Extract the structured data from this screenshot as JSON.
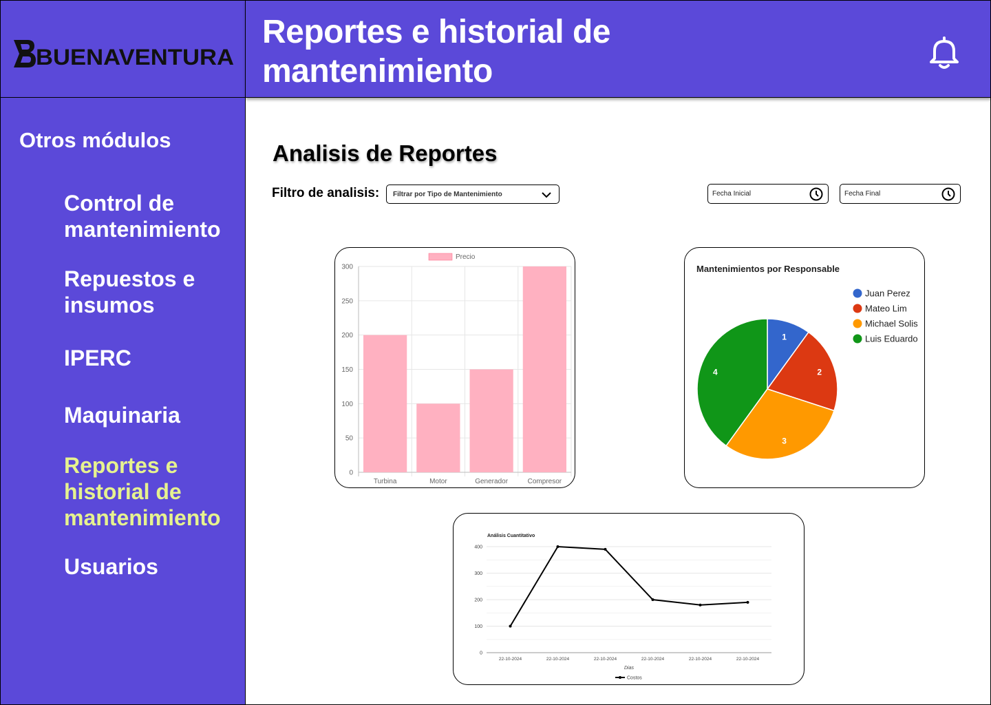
{
  "brand": {
    "logo_text": "BUENAVENTURA"
  },
  "header": {
    "title": "Reportes e historial de mantenimiento",
    "notification_icon": "bell-icon"
  },
  "sidebar": {
    "heading": "Otros módulos",
    "items": [
      {
        "label": "Control de mantenimiento",
        "active": false
      },
      {
        "label": "Repuestos e insumos",
        "active": false
      },
      {
        "label": "IPERC",
        "active": false
      },
      {
        "label": "Maquinaria",
        "active": false
      },
      {
        "label": "Reportes e historial de mantenimiento",
        "active": true
      },
      {
        "label": "Usuarios",
        "active": false
      }
    ]
  },
  "main": {
    "section_title": "Analisis de Reportes",
    "filter_label": "Filtro de analisis:",
    "filter_select": {
      "value": "Filtrar por Tipo de Mantenimiento",
      "icon": "chevron-down-icon"
    },
    "start_date": {
      "placeholder": "Fecha Inicial",
      "icon": "clock-icon"
    },
    "end_date": {
      "placeholder": "Fecha Final",
      "icon": "clock-icon"
    }
  },
  "colors": {
    "brand_purple": "#5b49d9",
    "active_nav": "#e6f28f",
    "bar_fill": "#ffb1c1",
    "pie": [
      "#3366cc",
      "#dc3912",
      "#ff9900",
      "#109618"
    ]
  },
  "chart_data": [
    {
      "type": "bar",
      "title": "",
      "legend": [
        "Precio"
      ],
      "legend_position": "top",
      "categories": [
        "Turbina",
        "Motor",
        "Generador",
        "Compresor"
      ],
      "series": [
        {
          "name": "Precio",
          "values": [
            200,
            100,
            150,
            300
          ]
        }
      ],
      "ylim": [
        0,
        300
      ],
      "yticks": [
        0,
        50,
        100,
        150,
        200,
        250,
        300
      ],
      "grid": true
    },
    {
      "type": "pie",
      "title": "Mantenimientos por Responsable",
      "legend_position": "right",
      "labels": [
        "Juan Perez",
        "Mateo Lim",
        "Michael Solis",
        "Luis Eduardo"
      ],
      "values": [
        1,
        2,
        3,
        4
      ]
    },
    {
      "type": "line",
      "title": "Análisis Cuantitativo",
      "xlabel": "Dias",
      "ylabel": "",
      "legend_position": "bottom",
      "x": [
        "22-10-2024",
        "22-10-2024",
        "22-10-2024",
        "22-10-2024",
        "22-10-2024",
        "22-10-2024"
      ],
      "series": [
        {
          "name": "Costos",
          "values": [
            100,
            400,
            390,
            200,
            180,
            190
          ]
        }
      ],
      "ylim": [
        0,
        400
      ],
      "yticks": [
        0,
        100,
        200,
        300,
        400
      ],
      "grid": true
    }
  ]
}
